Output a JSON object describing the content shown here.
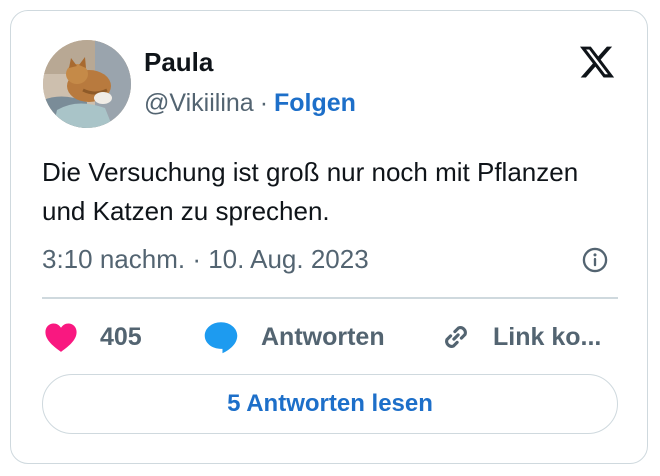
{
  "author": {
    "name": "Paula",
    "handle": "@Vikiilina",
    "separator": "·",
    "follow_label": "Folgen"
  },
  "tweet": {
    "text": "Die Versuchung ist groß nur noch mit Pflanzen und Katzen zu sprechen.",
    "timestamp": "3:10 nachm. · 10. Aug. 2023"
  },
  "actions": {
    "like_count": "405",
    "reply_label": "Antworten",
    "copy_link_label": "Link ko..."
  },
  "read_replies_label": "5 Antworten lesen",
  "icons": {
    "logo": "x-logo-icon",
    "info": "info-icon",
    "like": "heart-icon",
    "reply": "speech-bubble-icon",
    "copy": "link-icon"
  },
  "colors": {
    "accent": "#1d6fc9",
    "heart": "#f91880",
    "reply": "#1d9bf0",
    "secondary_text": "#536471",
    "border": "#cfd9de"
  }
}
